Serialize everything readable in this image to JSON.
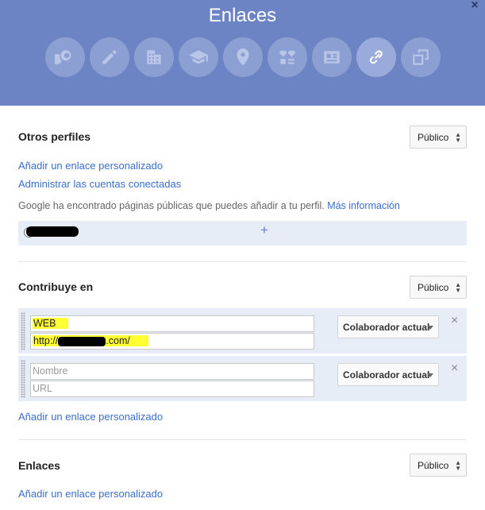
{
  "header": {
    "title": "Enlaces",
    "close_symbol": "×",
    "tabs": [
      {
        "icon": "story-icon"
      },
      {
        "icon": "pencil-icon"
      },
      {
        "icon": "building-icon"
      },
      {
        "icon": "graduation-cap-icon"
      },
      {
        "icon": "location-pin-icon"
      },
      {
        "icon": "hearts-icon"
      },
      {
        "icon": "contact-card-icon"
      },
      {
        "icon": "link-icon"
      },
      {
        "icon": "copy-icon"
      }
    ],
    "active_tab": "link-icon"
  },
  "sections": {
    "otros": {
      "title": "Otros perfiles",
      "privacy": "Público",
      "add_link": "Añadir un enlace personalizado",
      "manage_link": "Administrar las cuentas conectadas",
      "hint_text": "Google ha encontrado páginas públicas que puedes añadir a tu perfil.",
      "hint_more": "Más información",
      "plus": "+"
    },
    "contribuye": {
      "title": "Contribuye en",
      "privacy": "Público",
      "entries": [
        {
          "title_value": "WEB",
          "url_value": "http://",
          "url_suffix": ".com/",
          "role": "Colaborador actual",
          "remove": "×"
        },
        {
          "title_placeholder": "Nombre",
          "url_placeholder": "URL",
          "role": "Colaborador actual",
          "remove": "×"
        }
      ],
      "add_link": "Añadir un enlace personalizado"
    },
    "enlaces": {
      "title": "Enlaces",
      "privacy": "Público",
      "add_link": "Añadir un enlace personalizado"
    }
  },
  "colors": {
    "header_bg": "#6c84c4",
    "link": "#3a6fc8",
    "highlight": "#ffff33",
    "row_bg": "#e7edf7"
  }
}
